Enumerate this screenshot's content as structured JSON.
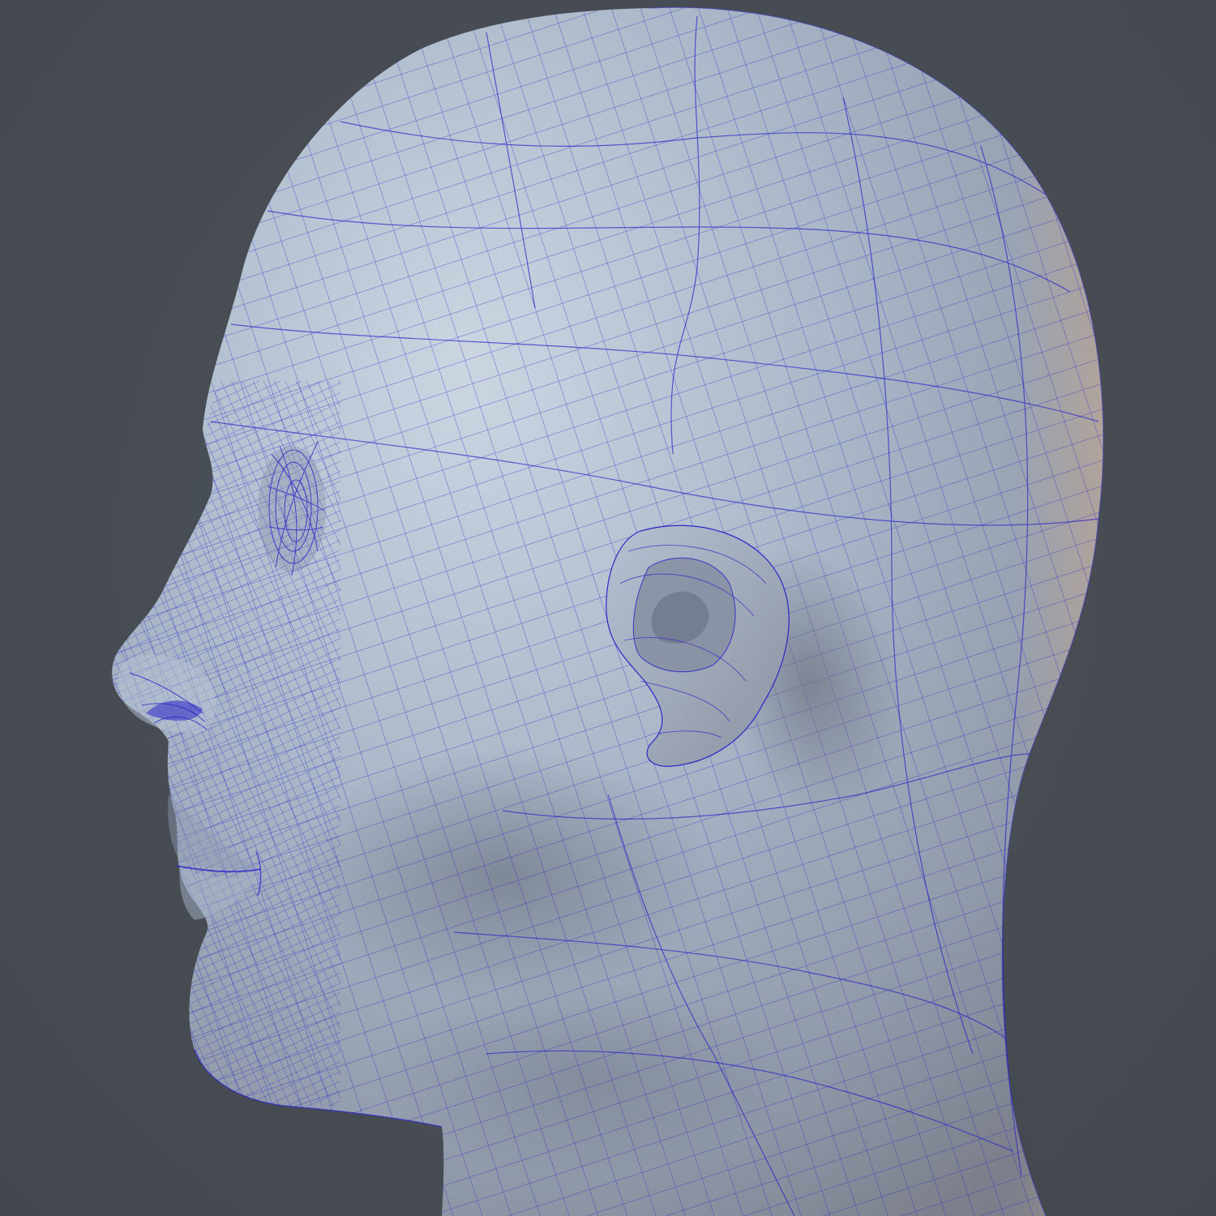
{
  "scene": {
    "background_color": "#474c53",
    "surface_color": "#a4b1c2",
    "surface_highlight_color": "#c6d2df",
    "surface_shadow_color": "#7d8391",
    "rim_light_color": "#c9a98e",
    "wireframe_color": "#2b24c8"
  }
}
